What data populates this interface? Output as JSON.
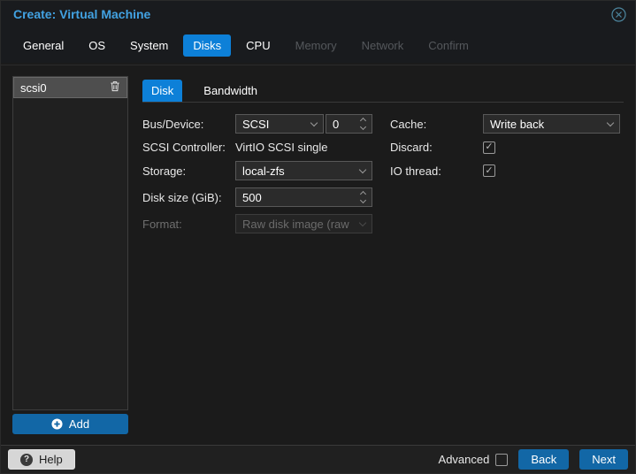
{
  "title_bar": {
    "title": "Create: Virtual Machine"
  },
  "wizard_tabs": [
    {
      "label": "General",
      "state": "enabled"
    },
    {
      "label": "OS",
      "state": "enabled"
    },
    {
      "label": "System",
      "state": "enabled"
    },
    {
      "label": "Disks",
      "state": "active"
    },
    {
      "label": "CPU",
      "state": "enabled"
    },
    {
      "label": "Memory",
      "state": "disabled"
    },
    {
      "label": "Network",
      "state": "disabled"
    },
    {
      "label": "Confirm",
      "state": "disabled"
    }
  ],
  "sidebar": {
    "disk_items": [
      {
        "label": "scsi0",
        "selected": true
      }
    ],
    "add_label": "Add"
  },
  "panel_tabs": {
    "disk": "Disk",
    "bandwidth": "Bandwidth",
    "active": "Disk"
  },
  "form": {
    "bus_device_label": "Bus/Device:",
    "bus_value": "SCSI",
    "device_number": "0",
    "cache_label": "Cache:",
    "cache_value": "Write back",
    "controller_label": "SCSI Controller:",
    "controller_value": "VirtIO SCSI single",
    "discard_label": "Discard:",
    "discard_checked": true,
    "storage_label": "Storage:",
    "storage_value": "local-zfs",
    "io_thread_label": "IO thread:",
    "io_thread_checked": true,
    "disk_size_label": "Disk size (GiB):",
    "disk_size_value": "500",
    "format_label": "Format:",
    "format_value": "Raw disk image (raw",
    "format_disabled": true
  },
  "footer": {
    "help": "Help",
    "advanced": "Advanced",
    "advanced_checked": false,
    "back": "Back",
    "next": "Next"
  },
  "colors": {
    "active_tab_blue": "#0d80d8",
    "button_blue": "#1267a6",
    "title_blue": "#42a2e2",
    "dialog_background": "#1b1b1b",
    "field_background": "#2b2b2b",
    "selected_item_gray": "#4e4e4e",
    "close_icon_teal": "#4d87a0"
  }
}
